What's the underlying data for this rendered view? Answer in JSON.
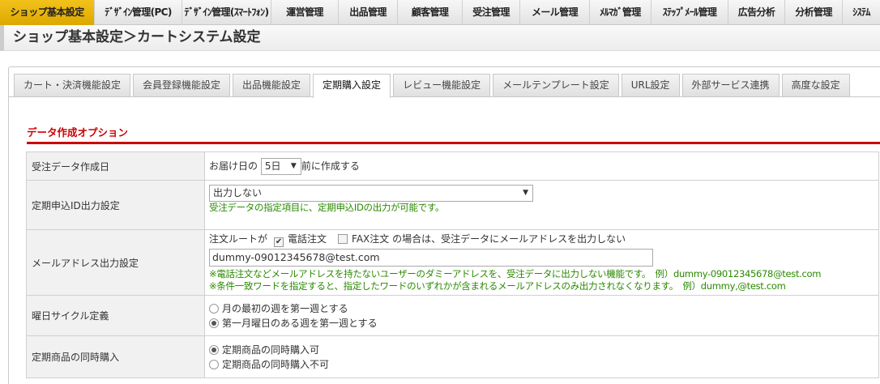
{
  "nav": [
    "ショップ基本設定",
    "ﾃﾞｻﾞｲﾝ管理(PC)",
    "ﾃﾞｻﾞｲﾝ管理(ｽﾏｰﾄﾌｫﾝ)",
    "運営管理",
    "出品管理",
    "顧客管理",
    "受注管理",
    "メール管理",
    "ﾒﾙﾏｶﾞ管理",
    "ｽﾃｯﾌﾟﾒｰﾙ管理",
    "広告分析",
    "分析管理",
    "ｼｽﾃﾑ"
  ],
  "title": "ショップ基本設定＞カートシステム設定",
  "tabs": [
    "カート・決済機能設定",
    "会員登録機能設定",
    "出品機能設定",
    "定期購入設定",
    "レビュー機能設定",
    "メールテンプレート設定",
    "URL設定",
    "外部サービス連携",
    "高度な設定"
  ],
  "section": "データ作成オプション",
  "rows": {
    "r1": {
      "label": "受注データ作成日",
      "pre": "お届け日の",
      "select": "5日",
      "post": "前に作成する"
    },
    "r2": {
      "label": "定期申込ID出力設定",
      "select": "出力しない",
      "note": "受注データの指定項目に、定期申込IDの出力が可能です。"
    },
    "r3": {
      "label": "メールアドレス出力設定",
      "pre": "注文ルートが",
      "cb1": "電話注文",
      "cb1_checked": true,
      "cb2": "FAX注文",
      "cb2_checked": false,
      "post": "の場合は、受注データにメールアドレスを出力しない",
      "input": "dummy-09012345678@test.com",
      "note1": "※電話注文などメールアドレスを持たないユーザーのダミーアドレスを、受注データに出力しない機能です。　例）dummy-09012345678@test.com",
      "note2": "※条件一致ワードを指定すると、指定したワードのいずれかが含まれるメールアドレスのみ出力されなくなります。　例）dummy,@test.com"
    },
    "r4": {
      "label": "曜日サイクル定義",
      "opt1": "月の最初の週を第一週とする",
      "opt2": "第一月曜日のある週を第一週とする",
      "selected": 2
    },
    "r5": {
      "label": "定期商品の同時購入",
      "opt1": "定期商品の同時購入可",
      "opt2": "定期商品の同時購入不可",
      "selected": 1
    }
  }
}
